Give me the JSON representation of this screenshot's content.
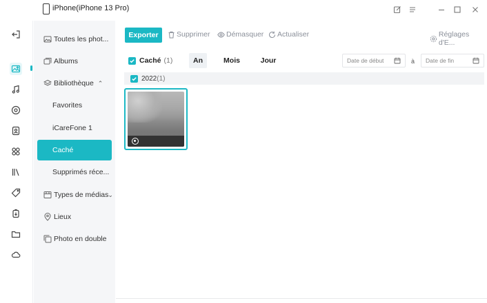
{
  "window": {
    "title": "iPhone(iPhone 13 Pro)",
    "controls": [
      "edit-icon",
      "menu-icon",
      "minimize-icon",
      "maximize-icon",
      "close-icon"
    ]
  },
  "rail": {
    "items": [
      "back-icon",
      "photos-icon",
      "music-icon",
      "video-icon",
      "contacts-icon",
      "apps-icon",
      "books-icon",
      "tags-icon",
      "backup-icon",
      "files-icon",
      "cloud-icon"
    ],
    "active": "photos-icon"
  },
  "nav": {
    "all_photos": "Toutes les phot...",
    "albums": "Albums",
    "library": "Bibliothèque",
    "library_sub": [
      "Favorites",
      "iCareFone 1",
      "Caché",
      "Supprimés réce..."
    ],
    "media_types": "Types de médias",
    "places": "Lieux",
    "duplicates": "Photo en double",
    "selected": "Caché"
  },
  "toolbar": {
    "export": "Exporter",
    "delete": "Supprimer",
    "unhide": "Démasquer",
    "refresh": "Actualiser",
    "settings": "Réglages d'E..."
  },
  "filters": {
    "category": "Caché",
    "category_count": "(1)",
    "tabs": [
      "An",
      "Mois",
      "Jour"
    ],
    "active_tab": "An",
    "start_date_placeholder": "Date de début",
    "separator": "à",
    "end_date_placeholder": "Date de fin"
  },
  "groups": [
    {
      "year": "2022",
      "count": "(1)"
    }
  ],
  "colors": {
    "accent": "#1bb8c4",
    "nav_bg": "#f5f6f8"
  }
}
